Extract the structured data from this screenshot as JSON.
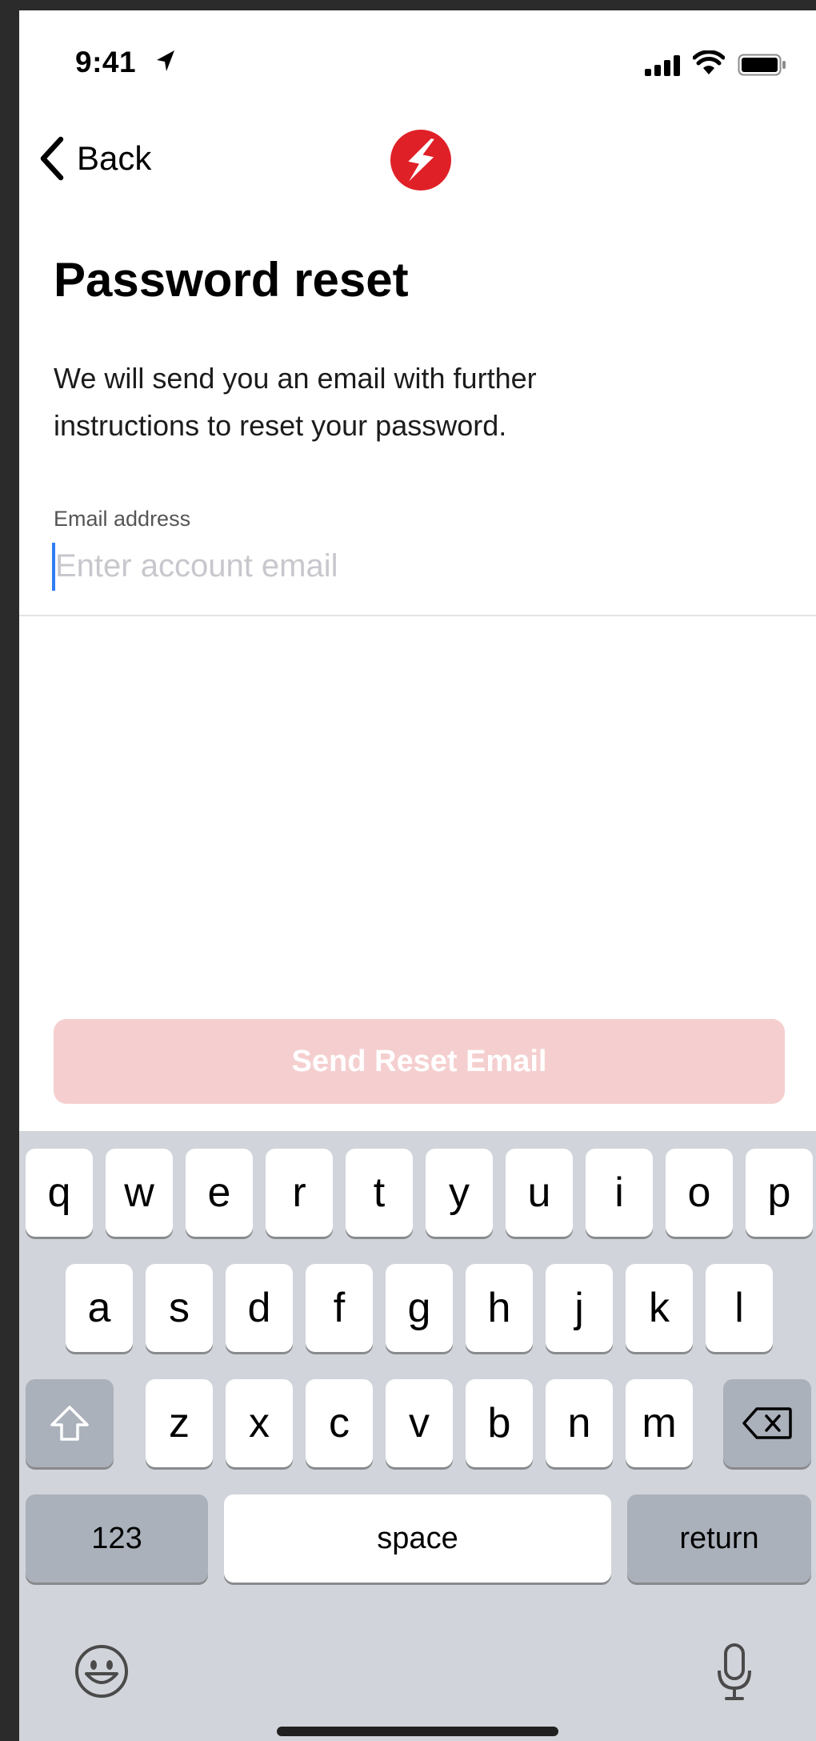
{
  "status_bar": {
    "time": "9:41"
  },
  "nav": {
    "back_label": "Back"
  },
  "header": {
    "title": "Password reset",
    "description": "We will send you an email with further instructions to reset your password."
  },
  "form": {
    "email_label": "Email address",
    "email_value": "",
    "email_placeholder": "Enter account email"
  },
  "actions": {
    "send_label": "Send Reset Email"
  },
  "colors": {
    "brand_red": "#e02027",
    "button_disabled_bg": "#f5cfcf",
    "caret_blue": "#2f7cf6"
  },
  "keyboard": {
    "row1": [
      "q",
      "w",
      "e",
      "r",
      "t",
      "y",
      "u",
      "i",
      "o",
      "p"
    ],
    "row2": [
      "a",
      "s",
      "d",
      "f",
      "g",
      "h",
      "j",
      "k",
      "l"
    ],
    "row3": [
      "z",
      "x",
      "c",
      "v",
      "b",
      "n",
      "m"
    ],
    "numbers_label": "123",
    "space_label": "space",
    "return_label": "return",
    "icons": [
      "shift-icon",
      "delete-icon",
      "emoji-icon",
      "microphone-icon"
    ]
  }
}
